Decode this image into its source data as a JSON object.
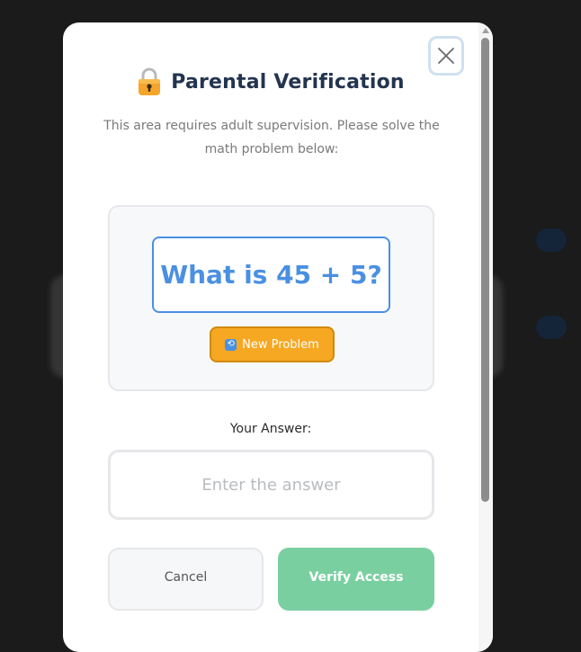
{
  "modal": {
    "title": "Parental Verification",
    "title_icon": "lock-icon",
    "subtitle": "This area requires adult supervision. Please solve the math problem below:",
    "close_icon": "close-icon"
  },
  "problem": {
    "question": "What is 45 + 5?",
    "new_problem_label": "New Problem",
    "new_problem_icon": "refresh-icon"
  },
  "answer": {
    "label": "Your Answer:",
    "placeholder": "Enter the answer",
    "value": ""
  },
  "actions": {
    "cancel_label": "Cancel",
    "verify_label": "Verify Access"
  },
  "colors": {
    "accent_blue": "#4a90e2",
    "new_problem_orange": "#f6a823",
    "verify_green": "#7acfa0",
    "title_navy": "#23344f"
  }
}
